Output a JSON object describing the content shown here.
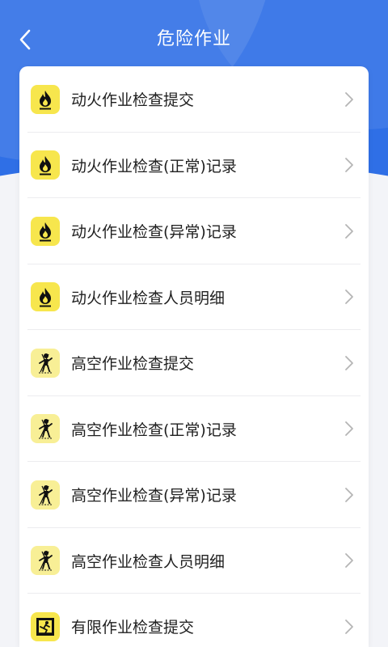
{
  "header": {
    "title": "危险作业",
    "back_icon": "chevron-left-icon"
  },
  "colors": {
    "primary": "#2f6fe6",
    "icon_bg": "#f7e64d",
    "icon_bg_light": "#f8ef96"
  },
  "menu": {
    "items": [
      {
        "label": "动火作业检查提交",
        "icon": "flame-icon"
      },
      {
        "label": "动火作业检查(正常)记录",
        "icon": "flame-icon"
      },
      {
        "label": "动火作业检查(异常)记录",
        "icon": "flame-icon"
      },
      {
        "label": "动火作业检查人员明细",
        "icon": "flame-icon"
      },
      {
        "label": "高空作业检查提交",
        "icon": "height-worker-icon"
      },
      {
        "label": "高空作业检查(正常)记录",
        "icon": "height-worker-icon"
      },
      {
        "label": "高空作业检查(异常)记录",
        "icon": "height-worker-icon"
      },
      {
        "label": "高空作业检查人员明细",
        "icon": "height-worker-icon"
      },
      {
        "label": "有限作业检查提交",
        "icon": "confined-space-icon"
      }
    ]
  }
}
